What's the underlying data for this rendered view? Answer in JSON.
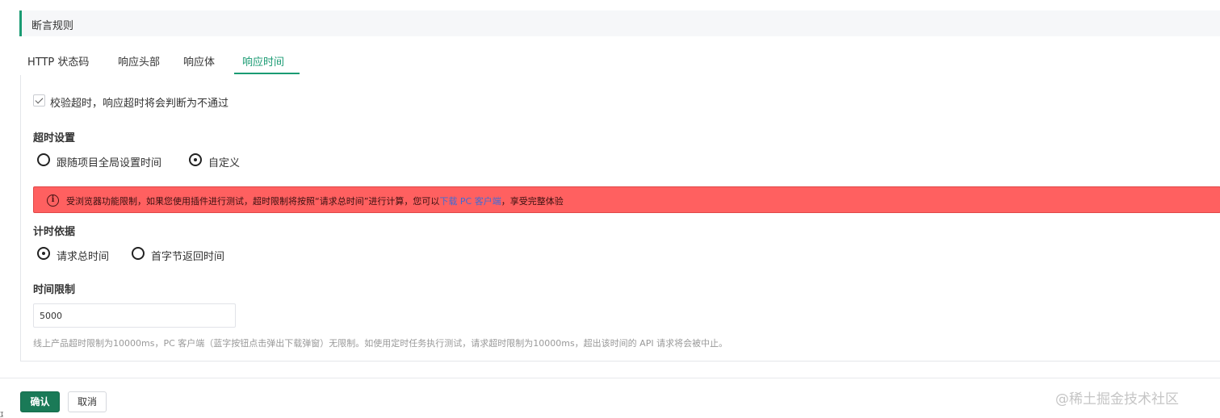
{
  "section": {
    "title": "断言规则"
  },
  "tabs": [
    {
      "label": "HTTP 状态码",
      "active": false
    },
    {
      "label": "响应头部",
      "active": false
    },
    {
      "label": "响应体",
      "active": false
    },
    {
      "label": "响应时间",
      "active": true
    }
  ],
  "timeout_check": {
    "checked": true,
    "label": "校验超时，响应超时将会判断为不通过"
  },
  "timeout_setting": {
    "title": "超时设置",
    "options": [
      {
        "label": "跟随项目全局设置时间",
        "selected": false
      },
      {
        "label": "自定义",
        "selected": true
      }
    ]
  },
  "alert": {
    "icon": "info-icon",
    "text_before": "受浏览器功能限制，如果您使用插件进行测试，超时限制将按照“请求总时间”进行计算，您可以",
    "link_text": "下载 PC 客户端",
    "text_after": "，享受完整体验"
  },
  "timing_basis": {
    "title": "计时依据",
    "options": [
      {
        "label": "请求总时间",
        "selected": true
      },
      {
        "label": "首字节返回时间",
        "selected": false
      }
    ]
  },
  "time_limit": {
    "title": "时间限制",
    "value": "5000",
    "hint": "线上产品超时限制为10000ms，PC 客户端（蓝字按钮点击弹出下载弹窗）无限制。如使用定时任务执行测试，请求超时限制为10000ms，超出该时间的 API 请求将会被中止。"
  },
  "footer": {
    "confirm_label": "确认",
    "cancel_label": "取消"
  },
  "watermark": "@稀土掘金技术社区",
  "edge_glyph": "功",
  "colors": {
    "accent": "#1a9b73",
    "alert_bg": "#ff6060",
    "link": "#3f6bd6",
    "confirm_bg": "#1a7a57"
  }
}
